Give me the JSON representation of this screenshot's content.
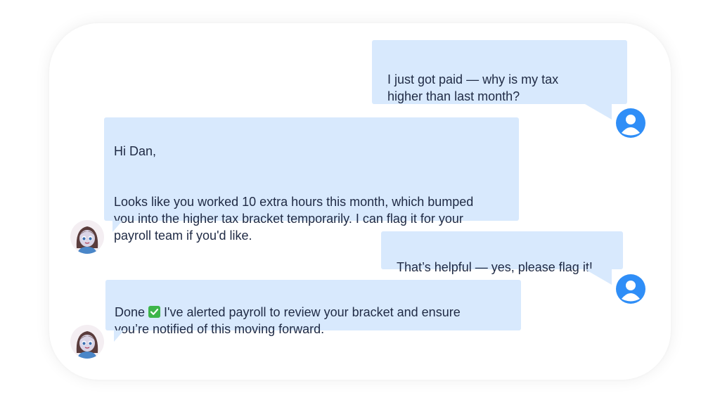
{
  "chat": {
    "messages": [
      {
        "sender": "user",
        "text": "I just got paid — why is my tax\nhigher than last month?"
      },
      {
        "sender": "assistant",
        "greeting": "Hi Dan,",
        "text": "Looks like you worked 10 extra hours this month, which bumped\nyou into the higher tax bracket temporarily. I can flag it for your\npayroll team if you'd like."
      },
      {
        "sender": "user",
        "text": "That’s helpful — yes, please flag it!"
      },
      {
        "sender": "assistant",
        "prefix": "Done",
        "check_icon": "check-mark-icon",
        "text": " I've alerted payroll to review your bracket and ensure\nyou’re notified of this moving forward."
      }
    ]
  },
  "colors": {
    "bubble": "#d8e9fd",
    "user_avatar": "#2f8ef7",
    "text": "#1f2a44"
  },
  "icons": {
    "user_avatar": "user-avatar-icon",
    "assistant_avatar": "assistant-avatar"
  }
}
